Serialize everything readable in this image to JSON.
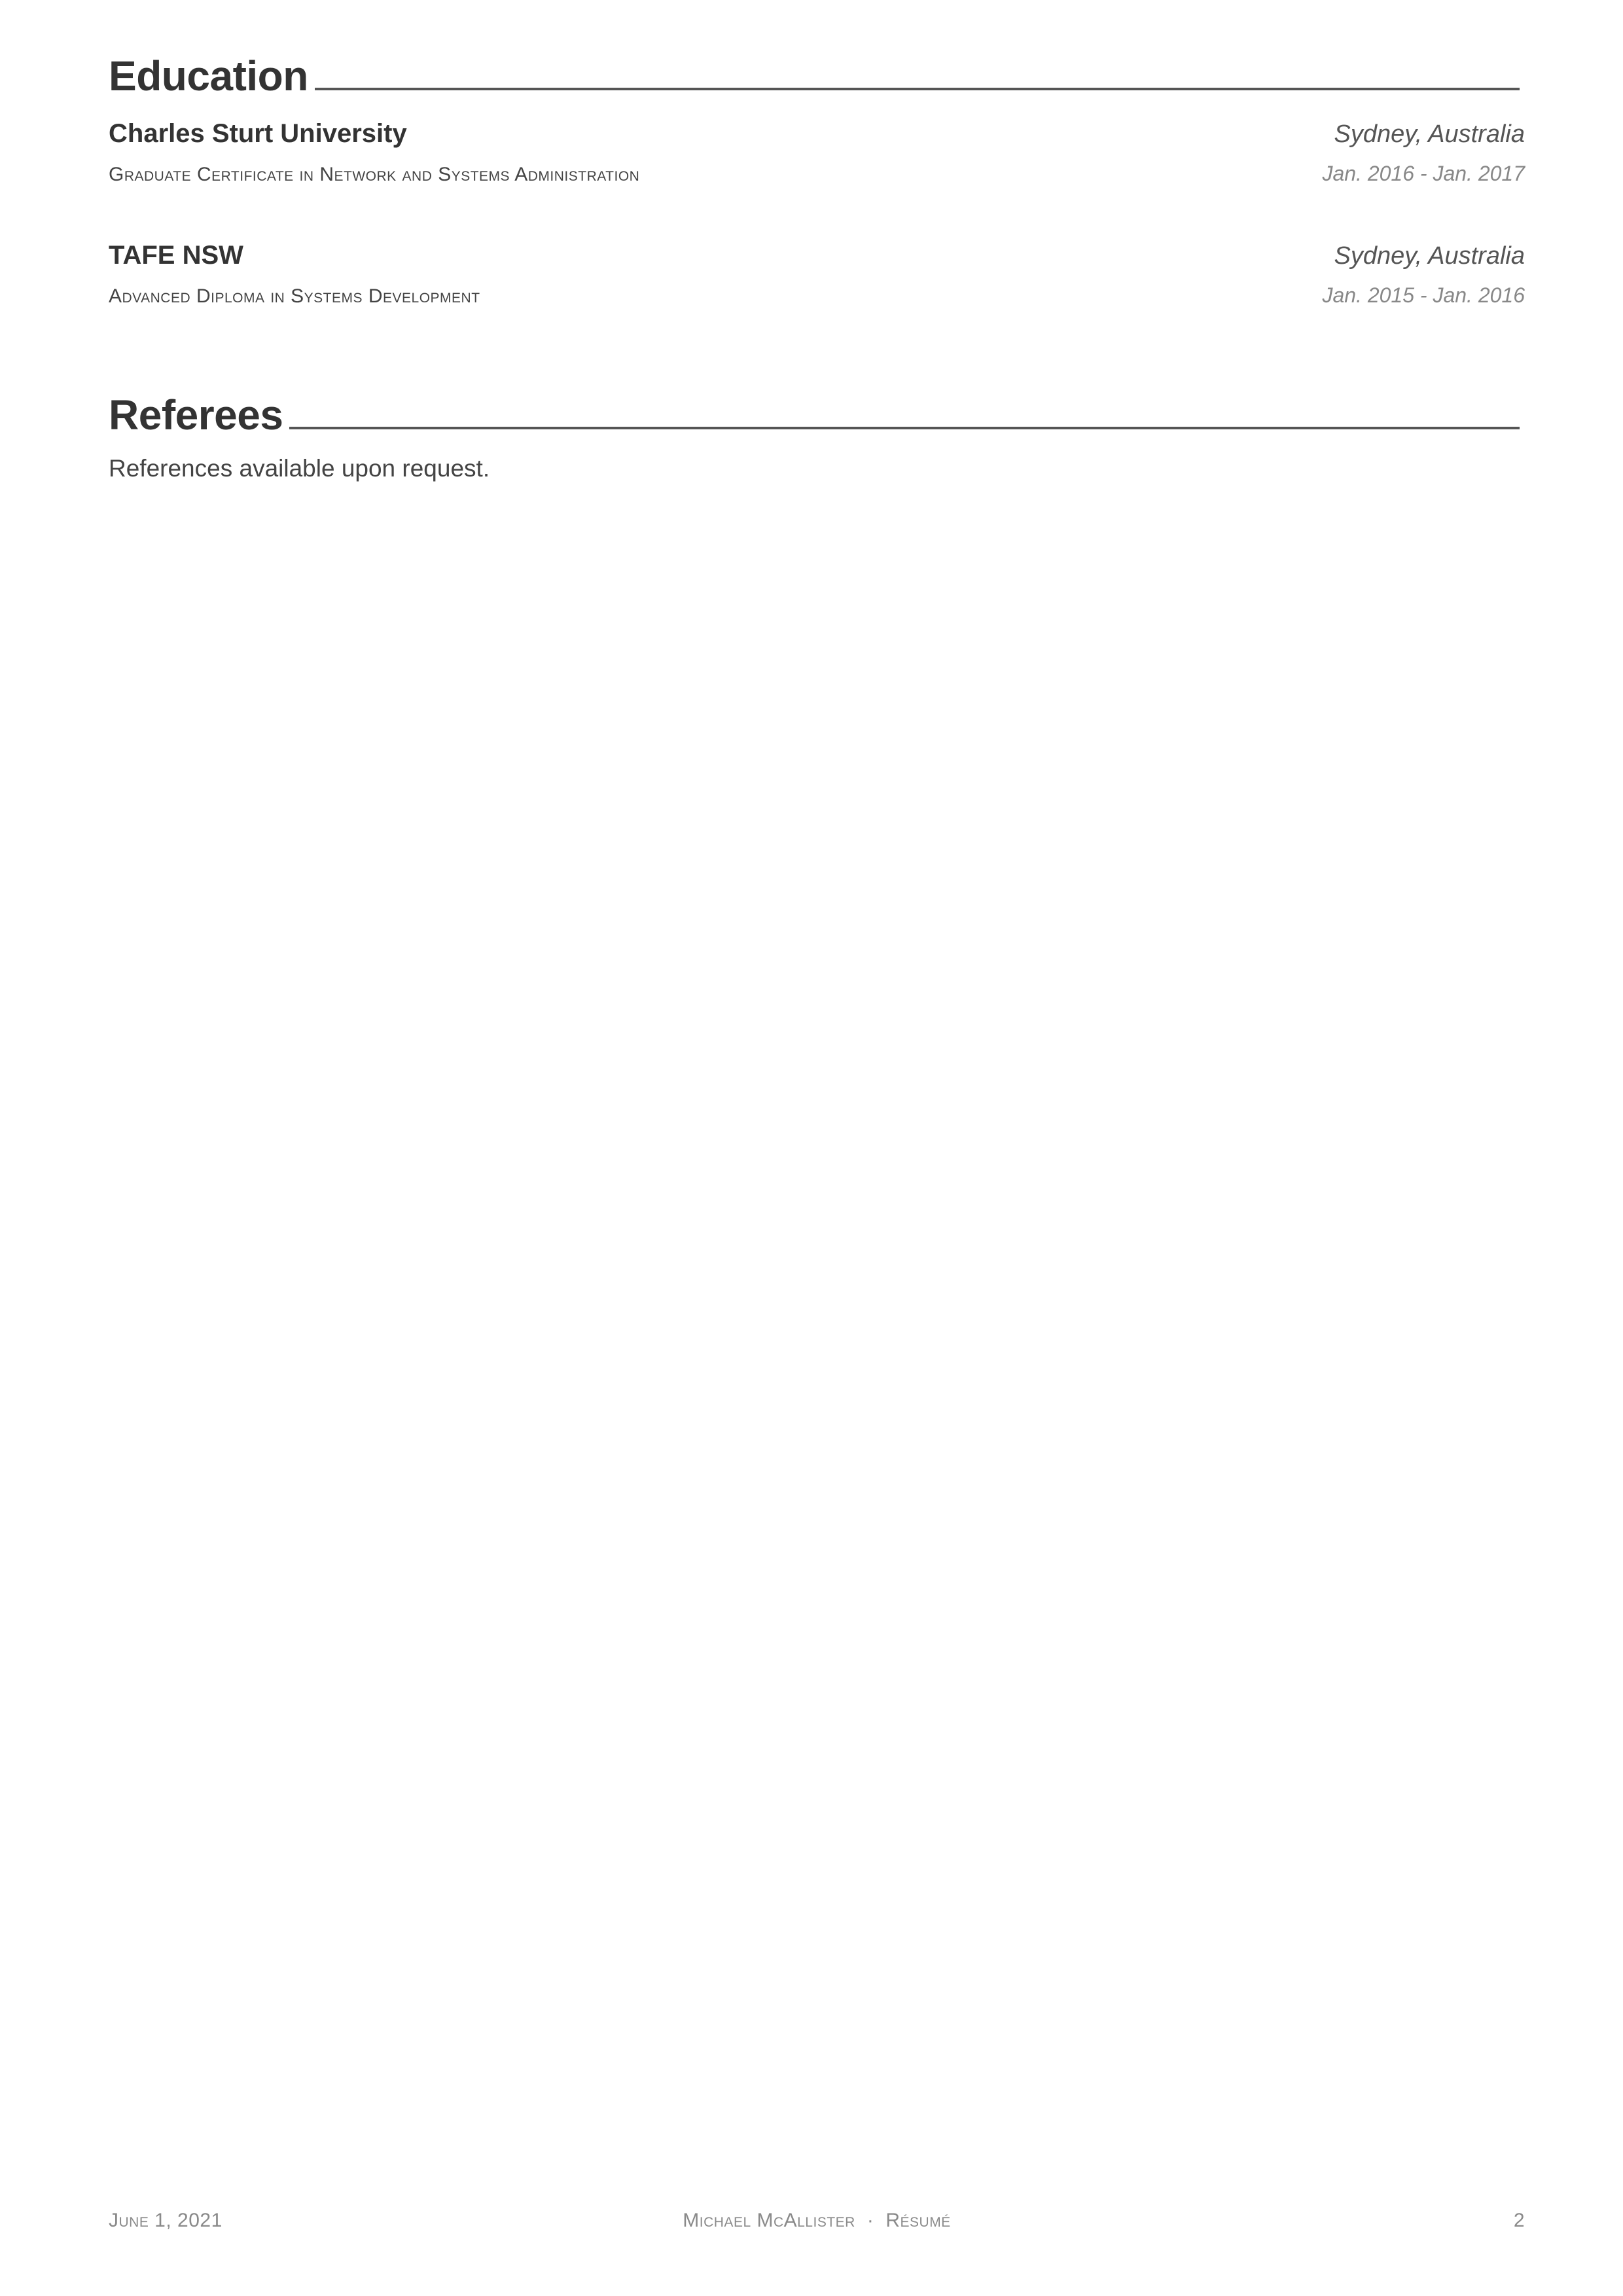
{
  "education": {
    "title": "Education",
    "entries": [
      {
        "institution": "Charles Sturt University",
        "location": "Sydney, Australia",
        "degree": "Graduate Certificate in Network and Systems Administration",
        "dates": "Jan. 2016 - Jan. 2017"
      },
      {
        "institution": "TAFE NSW",
        "location": "Sydney, Australia",
        "degree": "Advanced Diploma in Systems Development",
        "dates": "Jan. 2015 - Jan. 2016"
      }
    ]
  },
  "referees": {
    "title": "Referees",
    "text": "References available upon request."
  },
  "footer": {
    "date": "June 1, 2021",
    "name": "Michael McAllister",
    "separator": "·",
    "doc_type": "Résumé",
    "page_number": "2"
  }
}
